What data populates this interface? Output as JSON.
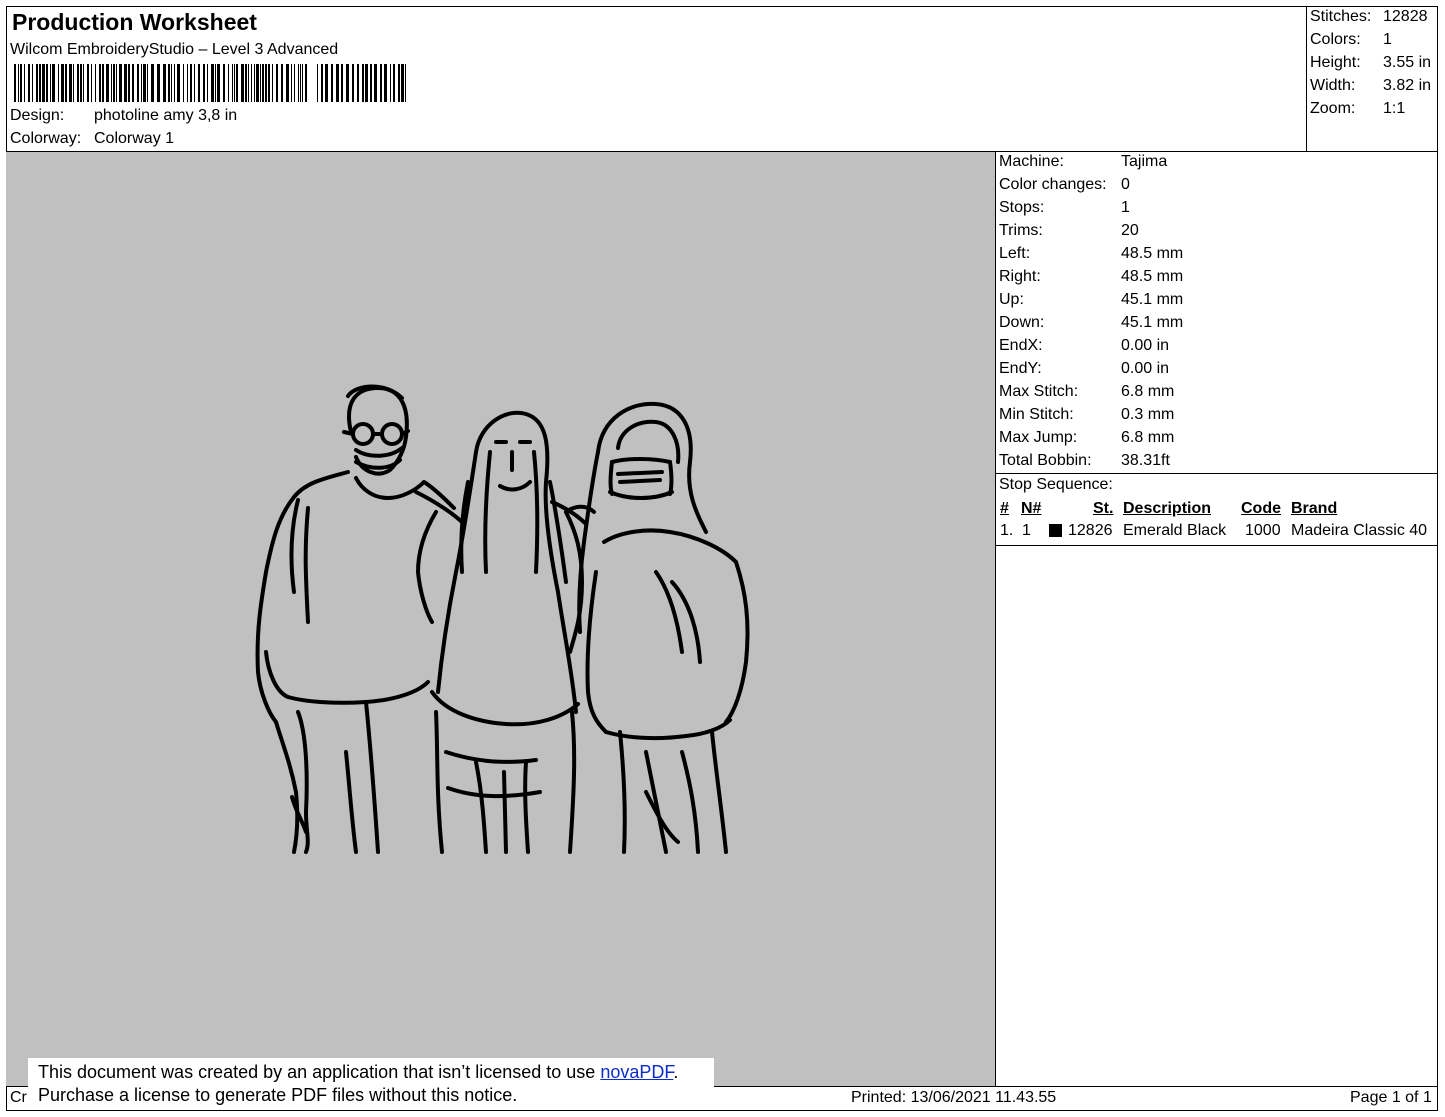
{
  "header": {
    "title": "Production Worksheet",
    "software": "Wilcom EmbroideryStudio – Level 3 Advanced",
    "design_label": "Design:",
    "design_value": "photoline amy 3,8 in",
    "colorway_label": "Colorway:",
    "colorway_value": "Colorway 1"
  },
  "summary": [
    {
      "label": "Stitches:",
      "value": "12828"
    },
    {
      "label": "Colors:",
      "value": "1"
    },
    {
      "label": "Height:",
      "value": "3.55 in"
    },
    {
      "label": "Width:",
      "value": "3.82 in"
    },
    {
      "label": "Zoom:",
      "value": "1:1"
    }
  ],
  "stats": [
    {
      "label": "Machine:",
      "value": "Tajima"
    },
    {
      "label": "Color changes:",
      "value": "0"
    },
    {
      "label": "Stops:",
      "value": "1"
    },
    {
      "label": "Trims:",
      "value": "20"
    },
    {
      "label": "Left:",
      "value": "48.5 mm"
    },
    {
      "label": "Right:",
      "value": "48.5 mm"
    },
    {
      "label": "Up:",
      "value": "45.1 mm"
    },
    {
      "label": "Down:",
      "value": "45.1 mm"
    },
    {
      "label": "EndX:",
      "value": "0.00 in"
    },
    {
      "label": "EndY:",
      "value": "0.00 in"
    },
    {
      "label": "Max Stitch:",
      "value": "6.8 mm"
    },
    {
      "label": "Min Stitch:",
      "value": "0.3 mm"
    },
    {
      "label": "Max Jump:",
      "value": "6.8 mm"
    },
    {
      "label": "Total Bobbin:",
      "value": "38.31ft"
    }
  ],
  "stop_sequence": {
    "title": "Stop Sequence:",
    "headers": {
      "num": "#",
      "needle": "N#",
      "stitches": "St.",
      "description": "Description",
      "code": "Code",
      "brand": "Brand"
    },
    "rows": [
      {
        "num": "1.",
        "needle": "1",
        "color": "#000000",
        "stitches": "12826",
        "description": "Emerald Black",
        "code": "1000",
        "brand": "Madeira Classic 40"
      }
    ]
  },
  "footer": {
    "left_text": "Cr",
    "printed": "Printed: 13/06/2021 11.43.55",
    "page": "Page 1 of 1"
  },
  "notice": {
    "line1_before": "This document was created by an application that isn’t licensed to use ",
    "link": "novaPDF",
    "line1_after": ".",
    "line2": "Purchase a license to generate PDF files without this notice."
  },
  "colors": {
    "canvas_bg": "#c0c0c0",
    "thread": "#000000",
    "link": "#0b2ccc"
  }
}
